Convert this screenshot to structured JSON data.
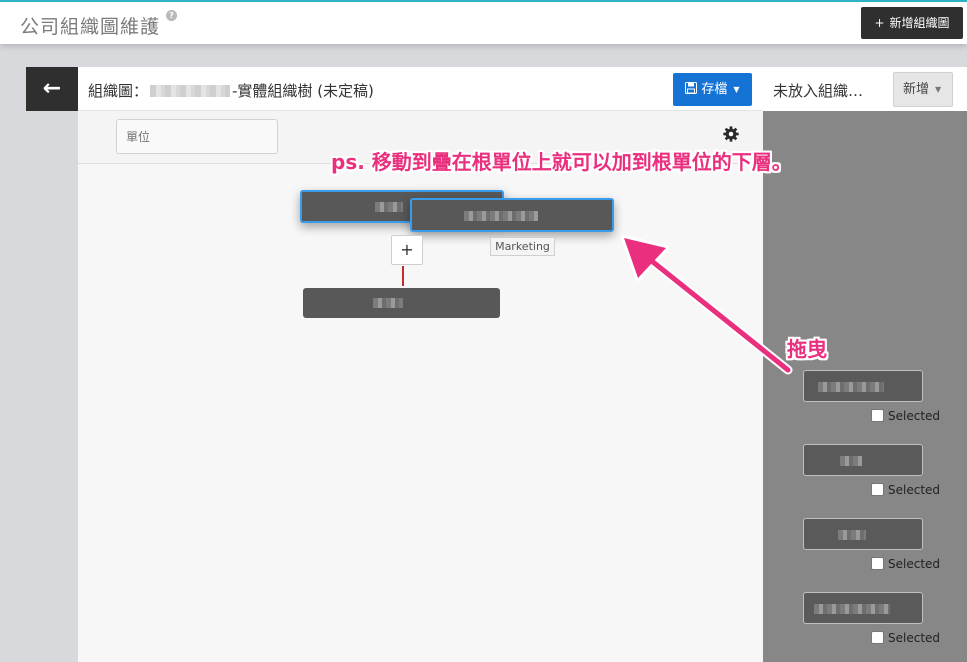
{
  "page": {
    "title": "公司組織圖維護",
    "help_icon": "question-icon"
  },
  "toolbar": {
    "add_org_label": "新增組織圖",
    "add_org_plus": "+"
  },
  "editor": {
    "title_prefix": "組織圖：",
    "title_suffix": "-實體組織樹 (未定稿)",
    "save_label": "存檔",
    "search_placeholder": "單位"
  },
  "unplaced": {
    "title": "未放入組織…",
    "new_label": "新增"
  },
  "tree": {
    "tooltip": "Marketing",
    "plus": "+"
  },
  "annotations": {
    "hint": "ps. 移動到疊在根單位上就可以加到根單位的下層。",
    "drag": "拖曳",
    "color": "#e92f7d"
  },
  "sidebar": {
    "items": [
      {
        "checkbox_label": "Selected",
        "checked": false
      },
      {
        "checkbox_label": "Selected",
        "checked": false
      },
      {
        "checkbox_label": "Selected",
        "checked": false
      },
      {
        "checkbox_label": "Selected",
        "checked": false
      }
    ]
  },
  "colors": {
    "primary": "#1673d6",
    "dark": "#2f2f2f",
    "node": "#585858",
    "selected_border": "#3b9bea",
    "topbar_accent": "#2fb2c4"
  }
}
